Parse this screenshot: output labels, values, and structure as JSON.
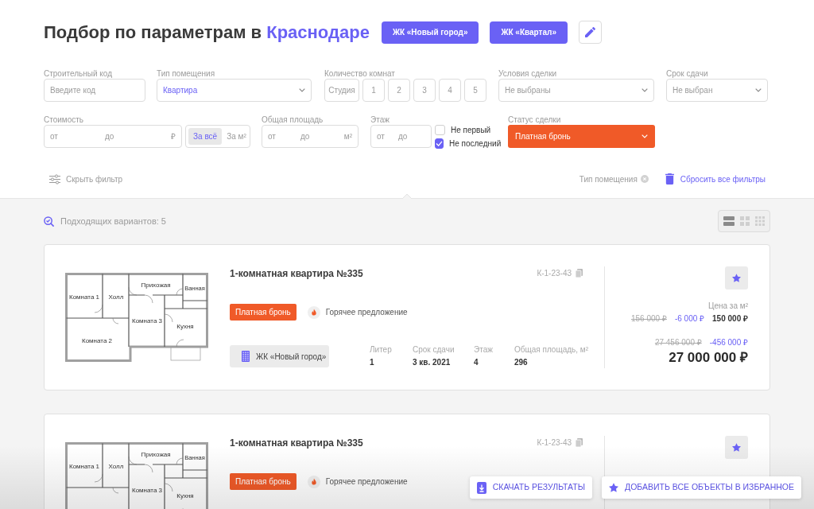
{
  "header": {
    "title": "Подбор по параметрам в",
    "city": "Краснодаре",
    "complex_buttons": [
      {
        "label": "ЖК «Новый город»"
      },
      {
        "label": "ЖК «Квартал»"
      }
    ]
  },
  "filters": {
    "build_code": {
      "label": "Строительный код",
      "placeholder": "Введите код"
    },
    "room_type": {
      "label": "Тип помещения",
      "value": "Квартира"
    },
    "rooms": {
      "label": "Количество комнат",
      "options": [
        {
          "label": "Студия",
          "selected": false
        },
        {
          "label": "1",
          "selected": false
        },
        {
          "label": "2",
          "selected": false
        },
        {
          "label": "3",
          "selected": false
        },
        {
          "label": "4",
          "selected": false
        },
        {
          "label": "5",
          "selected": false
        }
      ]
    },
    "deal_terms": {
      "label": "Условия сделки",
      "placeholder": "Не выбраны"
    },
    "deadline": {
      "label": "Срок сдачи",
      "placeholder": "Не выбран"
    },
    "price": {
      "label": "Стоимость",
      "from": {
        "placeholder": "от"
      },
      "to": {
        "placeholder": "до"
      },
      "unit": "₽",
      "modes": [
        {
          "label": "За всё",
          "selected": true
        },
        {
          "label": "За м²",
          "selected": false
        }
      ]
    },
    "area": {
      "label": "Общая площадь",
      "from": {
        "placeholder": "от"
      },
      "to": {
        "placeholder": "до"
      },
      "unit": "м²"
    },
    "floor": {
      "label": "Этаж",
      "from": {
        "placeholder": "от"
      },
      "to": {
        "placeholder": "до"
      },
      "options": [
        {
          "label": "Не первый",
          "checked": false
        },
        {
          "label": "Не последний",
          "checked": true
        }
      ]
    },
    "deal_status": {
      "label": "Статус сделки",
      "value": "Платная бронь"
    }
  },
  "filter_bar": {
    "toggle": "Скрыть фильтр",
    "active_filters": [
      {
        "label": "Тип помещения"
      }
    ],
    "reset": "Сбросить все фильтры"
  },
  "results": {
    "count": "Подходящих вариантов: 5",
    "views": [
      {
        "kind": "list",
        "selected": true
      },
      {
        "kind": "grid",
        "selected": false
      },
      {
        "kind": "tiles",
        "selected": false
      }
    ]
  },
  "listings": [
    {
      "plan_rooms": [
        "Комната 1",
        "Холл",
        "Прихожая",
        "Ванная",
        "Комната 3",
        "Кухня",
        "Комната 2"
      ],
      "title": "1-комнатная квартира №335",
      "code": "К-1-23-43",
      "status": "Платная бронь",
      "tag": "Горячее предложение",
      "complex": "ЖК «Новый город»",
      "specs": [
        {
          "label": "Литер",
          "value": "1"
        },
        {
          "label": "Срок сдачи",
          "value": "3 кв. 2021"
        },
        {
          "label": "Этаж",
          "value": "4"
        },
        {
          "label": "Общая площадь, м²",
          "value": "296"
        }
      ],
      "price_per_m2": {
        "label": "Цена за м²",
        "old": "156 000 ₽",
        "discount": "-6 000 ₽",
        "current": "150 000 ₽"
      },
      "price": {
        "old": "27 456 000 ₽",
        "discount": "-456 000 ₽",
        "current": "27 000 000 ₽"
      }
    },
    {
      "plan_rooms": [
        "Комната 1",
        "Холл",
        "Прихожая",
        "Ванная",
        "Комната 3",
        "Кухня"
      ],
      "title": "1-комнатная квартира №335",
      "code": "К-1-23-43",
      "status": "Платная бронь",
      "tag": "Горячее предложение"
    }
  ],
  "actions": [
    {
      "kind": "download",
      "label": "СКАЧАТЬ РЕЗУЛЬТАТЫ"
    },
    {
      "kind": "favorite",
      "label": "ДОБАВИТЬ ВСЕ ОБЪЕКТЫ В ИЗБРАННОЕ"
    }
  ]
}
